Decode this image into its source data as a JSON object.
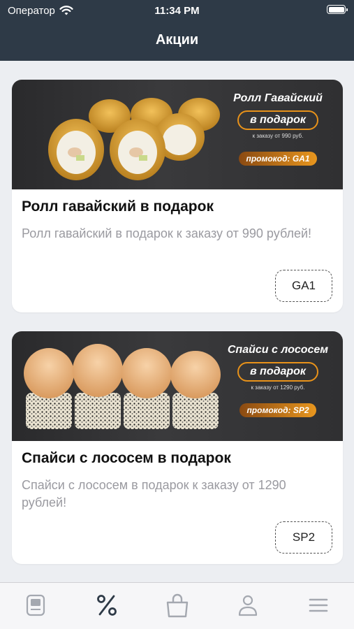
{
  "status_bar": {
    "carrier": "Оператор",
    "time": "11:34 PM"
  },
  "nav": {
    "title": "Акции"
  },
  "promos": [
    {
      "banner_title": "Ролл Гавайский",
      "banner_gift": "в подарок",
      "banner_note": "к заказу от 990 руб.",
      "banner_promocode": "промокод: GA1",
      "title": "Ролл гавайский в подарок",
      "description": "Ролл гавайский в подарок к заказу от 990 рублей!",
      "code": "GA1"
    },
    {
      "banner_title": "Спайси с лососем",
      "banner_gift": "в подарок",
      "banner_note": "к заказу от 1290 руб.",
      "banner_promocode": "промокод: SP2",
      "title": "Спайси с лососем в подарок",
      "description": "Спайси с лососем в подарок к заказу от 1290 рублей!",
      "code": "SP2"
    }
  ],
  "tab_bar": {
    "tabs": [
      {
        "icon": "menu-icon",
        "active": false
      },
      {
        "icon": "percent-icon",
        "active": true
      },
      {
        "icon": "bag-icon",
        "active": false
      },
      {
        "icon": "profile-icon",
        "active": false
      },
      {
        "icon": "hamburger-icon",
        "active": false
      }
    ]
  },
  "colors": {
    "nav_bg": "#2e3a47",
    "accent_orange": "#e8921a",
    "inactive_icon": "#a4a8b0",
    "active_icon": "#2e3a47"
  }
}
